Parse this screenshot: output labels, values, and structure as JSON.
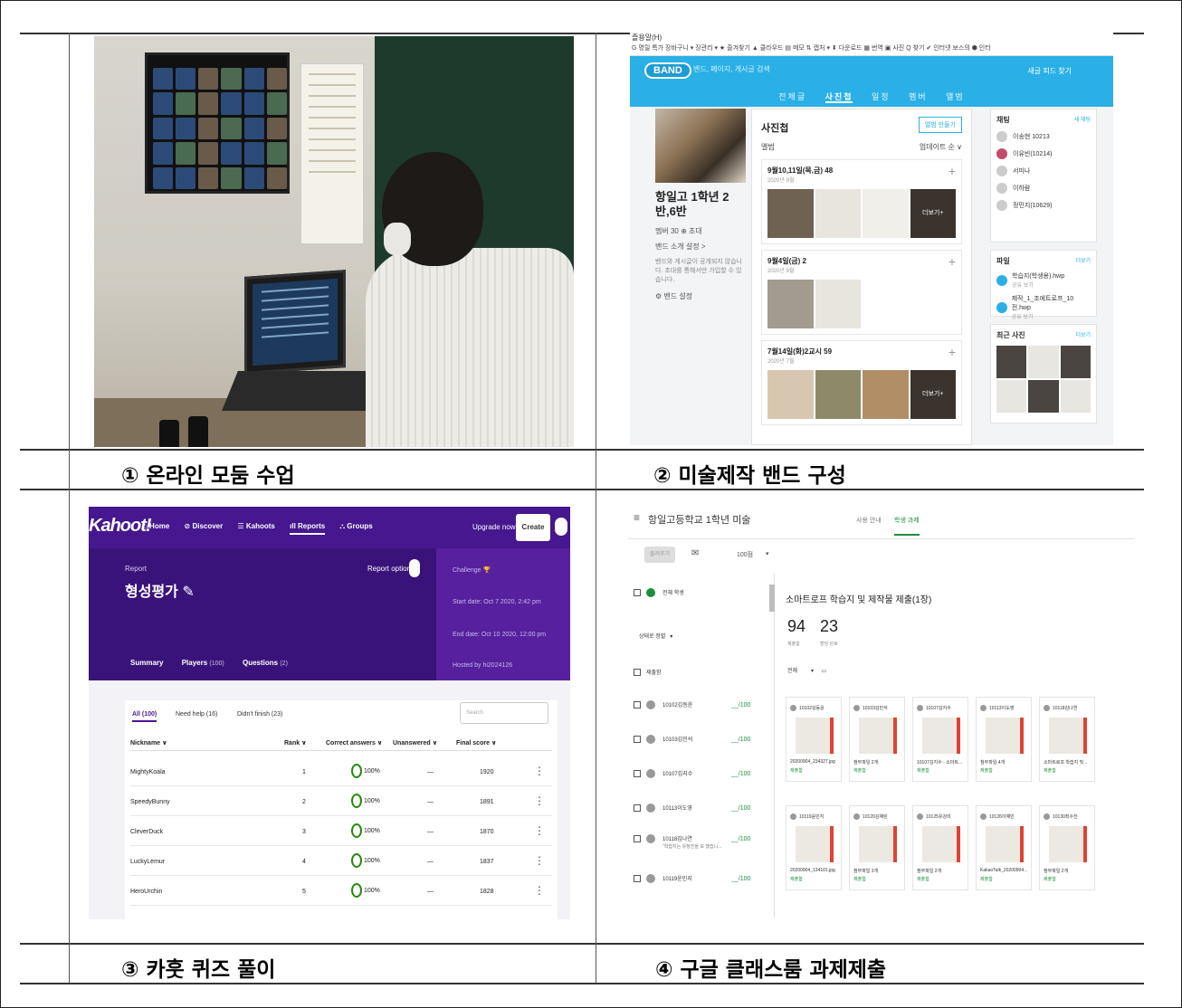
{
  "captions": {
    "c1": "① 온라인 모둠 수업",
    "c2": "② 미술제작 밴드 구성",
    "c3": "③ 카훗 퀴즈 풀이",
    "c4": "④ 구글 클래스룸 과제제출"
  },
  "band": {
    "menu": "즐용말(H)",
    "bookmarks": "G 명릴 특가  장바구니 ▾ 장관리 ▾ ★ 즐겨찾기 ▲ 클라우드 ▤ 메모 ⇅ 캡처 ▾ ⬇ 다운로드 ▦ 번역 ▣ 사진 Q 찾기 ✔ 인터넷 보스의 ⬢ 인터",
    "logo": "BAND",
    "search_placeholder": "밴드, 페이지, 게시글 검색",
    "top_right": "새글 피드   찾기",
    "tabs": [
      "전체글",
      "사진첩",
      "일정",
      "멤버",
      "앨범"
    ],
    "group_name": "항일고 1학년 2반,6반",
    "members": "멤버 30  ⊕ 초대",
    "intro_link": "밴드 소개 설정 >",
    "intro_text": "밴드와 게시글이 공개되지 않습니다. 초대를 통해서만 가입할 수 있습니다.",
    "settings": "⚙ 밴드 설정",
    "album_title": "사진첩",
    "make_album": "앨범 만들기",
    "album_label": "앨범",
    "sort": "업데이트 순 ∨",
    "albums": [
      {
        "title": "9월10,11일(목,금) 48",
        "date": "2020년 9월",
        "more": "더보기+"
      },
      {
        "title": "9월4일(금) 2",
        "date": "2020년 9월",
        "more": ""
      },
      {
        "title": "7월14일(화)2교시 59",
        "date": "2020년 7월",
        "more": "더보기+"
      }
    ],
    "chat_title": "채팅",
    "chat_new": "새 채팅",
    "chat_members": [
      "이송현 10213",
      "이유빈(10214)",
      "서미나",
      "이하람",
      "정민지(10629)"
    ],
    "file_title": "파일",
    "file_more": "더보기",
    "files": [
      {
        "name": "학습지(학생용).hwp",
        "sub": "공유 보기"
      },
      {
        "name": "제작_1_조에트로프_10전.hwp",
        "sub": "공유 보기"
      }
    ],
    "recent_title": "최근 사진",
    "recent_more": "더보기"
  },
  "kahoot": {
    "logo": "Kahoot!",
    "nav": [
      "⌂ Home",
      "⊘ Discover",
      "☰ Kahoots",
      "ıll Reports",
      "⛬ Groups"
    ],
    "upgrade": "Upgrade now",
    "create": "Create",
    "report_label": "Report",
    "title": "형성평가 ✎",
    "report_options": "Report options",
    "challenge": "Challenge 🏆",
    "start": "Start date: Oct 7 2020, 2:42 pm",
    "end": "End date: Oct 10 2020, 12:00 pm",
    "host": "Hosted by hi2024126",
    "tabs": {
      "summary": "Summary",
      "players": "Players",
      "players_n": "(100)",
      "questions": "Questions",
      "questions_n": "(2)"
    },
    "filters": [
      "All (100)",
      "Need help (16)",
      "Didn't finish (23)"
    ],
    "search": "Search",
    "headers": {
      "nick": "Nickname ∨",
      "rank": "Rank ∨",
      "correct": "Correct answers ∨",
      "unanswered": "Unanswered ∨",
      "score": "Final score ∨"
    },
    "rows": [
      {
        "nick": "MightyKoala",
        "rank": "1",
        "correct": "100%",
        "un": "—",
        "score": "1920"
      },
      {
        "nick": "SpeedyBunny",
        "rank": "2",
        "correct": "100%",
        "un": "—",
        "score": "1891"
      },
      {
        "nick": "CleverDuck",
        "rank": "3",
        "correct": "100%",
        "un": "—",
        "score": "1870"
      },
      {
        "nick": "LuckyLemur",
        "rank": "4",
        "correct": "100%",
        "un": "—",
        "score": "1837"
      },
      {
        "nick": "HeroUrchin",
        "rank": "5",
        "correct": "100%",
        "un": "—",
        "score": "1828"
      }
    ]
  },
  "classroom": {
    "menu": "≡",
    "class_name": "항일고등학교 1학년 미술",
    "tabs": [
      "사용 안내",
      "학생 과제"
    ],
    "return_btn": "돌려주기",
    "points": "100점",
    "all_students": "전체 학생",
    "sort": "상태로 정렬",
    "submitted_label": "제출함",
    "students": [
      {
        "name": "10102김동윤",
        "grade": "__/100"
      },
      {
        "name": "10103김민석",
        "grade": "__/100"
      },
      {
        "name": "10107김지수",
        "grade": "__/100"
      },
      {
        "name": "10113이도영",
        "grade": "__/100"
      },
      {
        "name": "10118김나연",
        "sub": "\"학습지는 유정진을 모 했습니...",
        "grade": "__/100"
      },
      {
        "name": "10119윤민지",
        "grade": "__/100"
      }
    ],
    "assignment": "소마트로프 학습지 및 제작물 제출(1장)",
    "stats": [
      {
        "n": "94",
        "label": "제출함"
      },
      {
        "n": "23",
        "label": "할당 완료"
      }
    ],
    "filter": "전체",
    "cards": [
      {
        "name": "10102김동윤",
        "file": "20200904_234327.jpg",
        "status": "제출함"
      },
      {
        "name": "10103김민석",
        "file": "첨부파일 2개",
        "status": "제출함"
      },
      {
        "name": "10107김지수",
        "file": "10107김지수 - 소마트...",
        "status": "제출함"
      },
      {
        "name": "10113이도영",
        "file": "첨부파일 4개",
        "status": "제출함"
      },
      {
        "name": "10118김나연",
        "file": "소마트로프 학습지 및...",
        "status": "제출함"
      },
      {
        "name": "10119윤민지",
        "file": "20200904_134101.jpg",
        "status": "제출함"
      },
      {
        "name": "10120김채린",
        "file": "첨부파일 3개",
        "status": "제출함"
      },
      {
        "name": "10125유강미",
        "file": "첨부파일 2개",
        "status": "제출함"
      },
      {
        "name": "10126이예빈",
        "file": "KakaoTalk_20200904...",
        "status": "제출함"
      },
      {
        "name": "10130최수진",
        "file": "첨부파일 2개",
        "status": "제출함"
      }
    ]
  }
}
